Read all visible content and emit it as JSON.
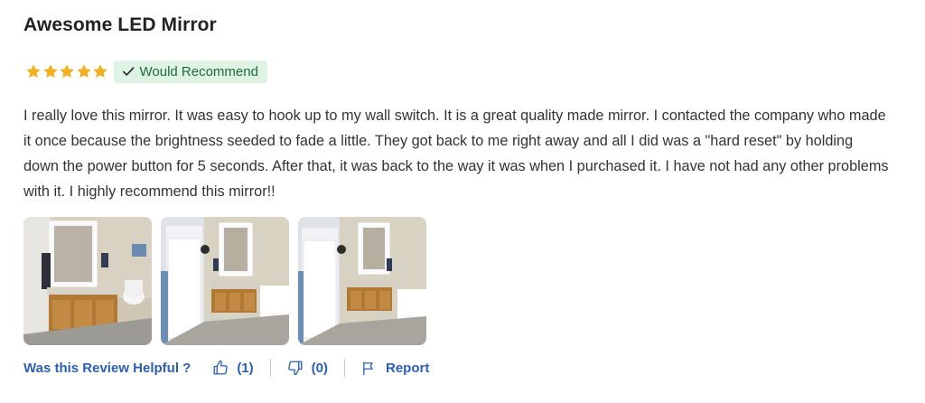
{
  "review": {
    "title": "Awesome LED Mirror",
    "rating": 5,
    "rating_max": 5,
    "star_color": "#f2b01e",
    "badge": {
      "label": "Would Recommend",
      "icon": "check-icon",
      "bg_color": "#dff3e4",
      "text_color": "#1f6b3c"
    },
    "body": "I really love this mirror. It was easy to hook up to my wall switch. It is a great quality made mirror. I contacted the company who made it once because the brightness seeded to fade a little. They got back to me right away and all I did was a \"hard reset\" by holding down the power button for 5 seconds. After that, it was back to the way it was when I purchased it. I have not had any other problems with it. I highly recommend this mirror!!",
    "photos": [
      {
        "name": "review-photo-1"
      },
      {
        "name": "review-photo-2"
      },
      {
        "name": "review-photo-3"
      }
    ]
  },
  "footer": {
    "helpful_question": "Was this Review Helpful ?",
    "helpful_count": "(1)",
    "unhelpful_count": "(0)",
    "report_label": "Report",
    "link_color": "#2a5fb5"
  }
}
